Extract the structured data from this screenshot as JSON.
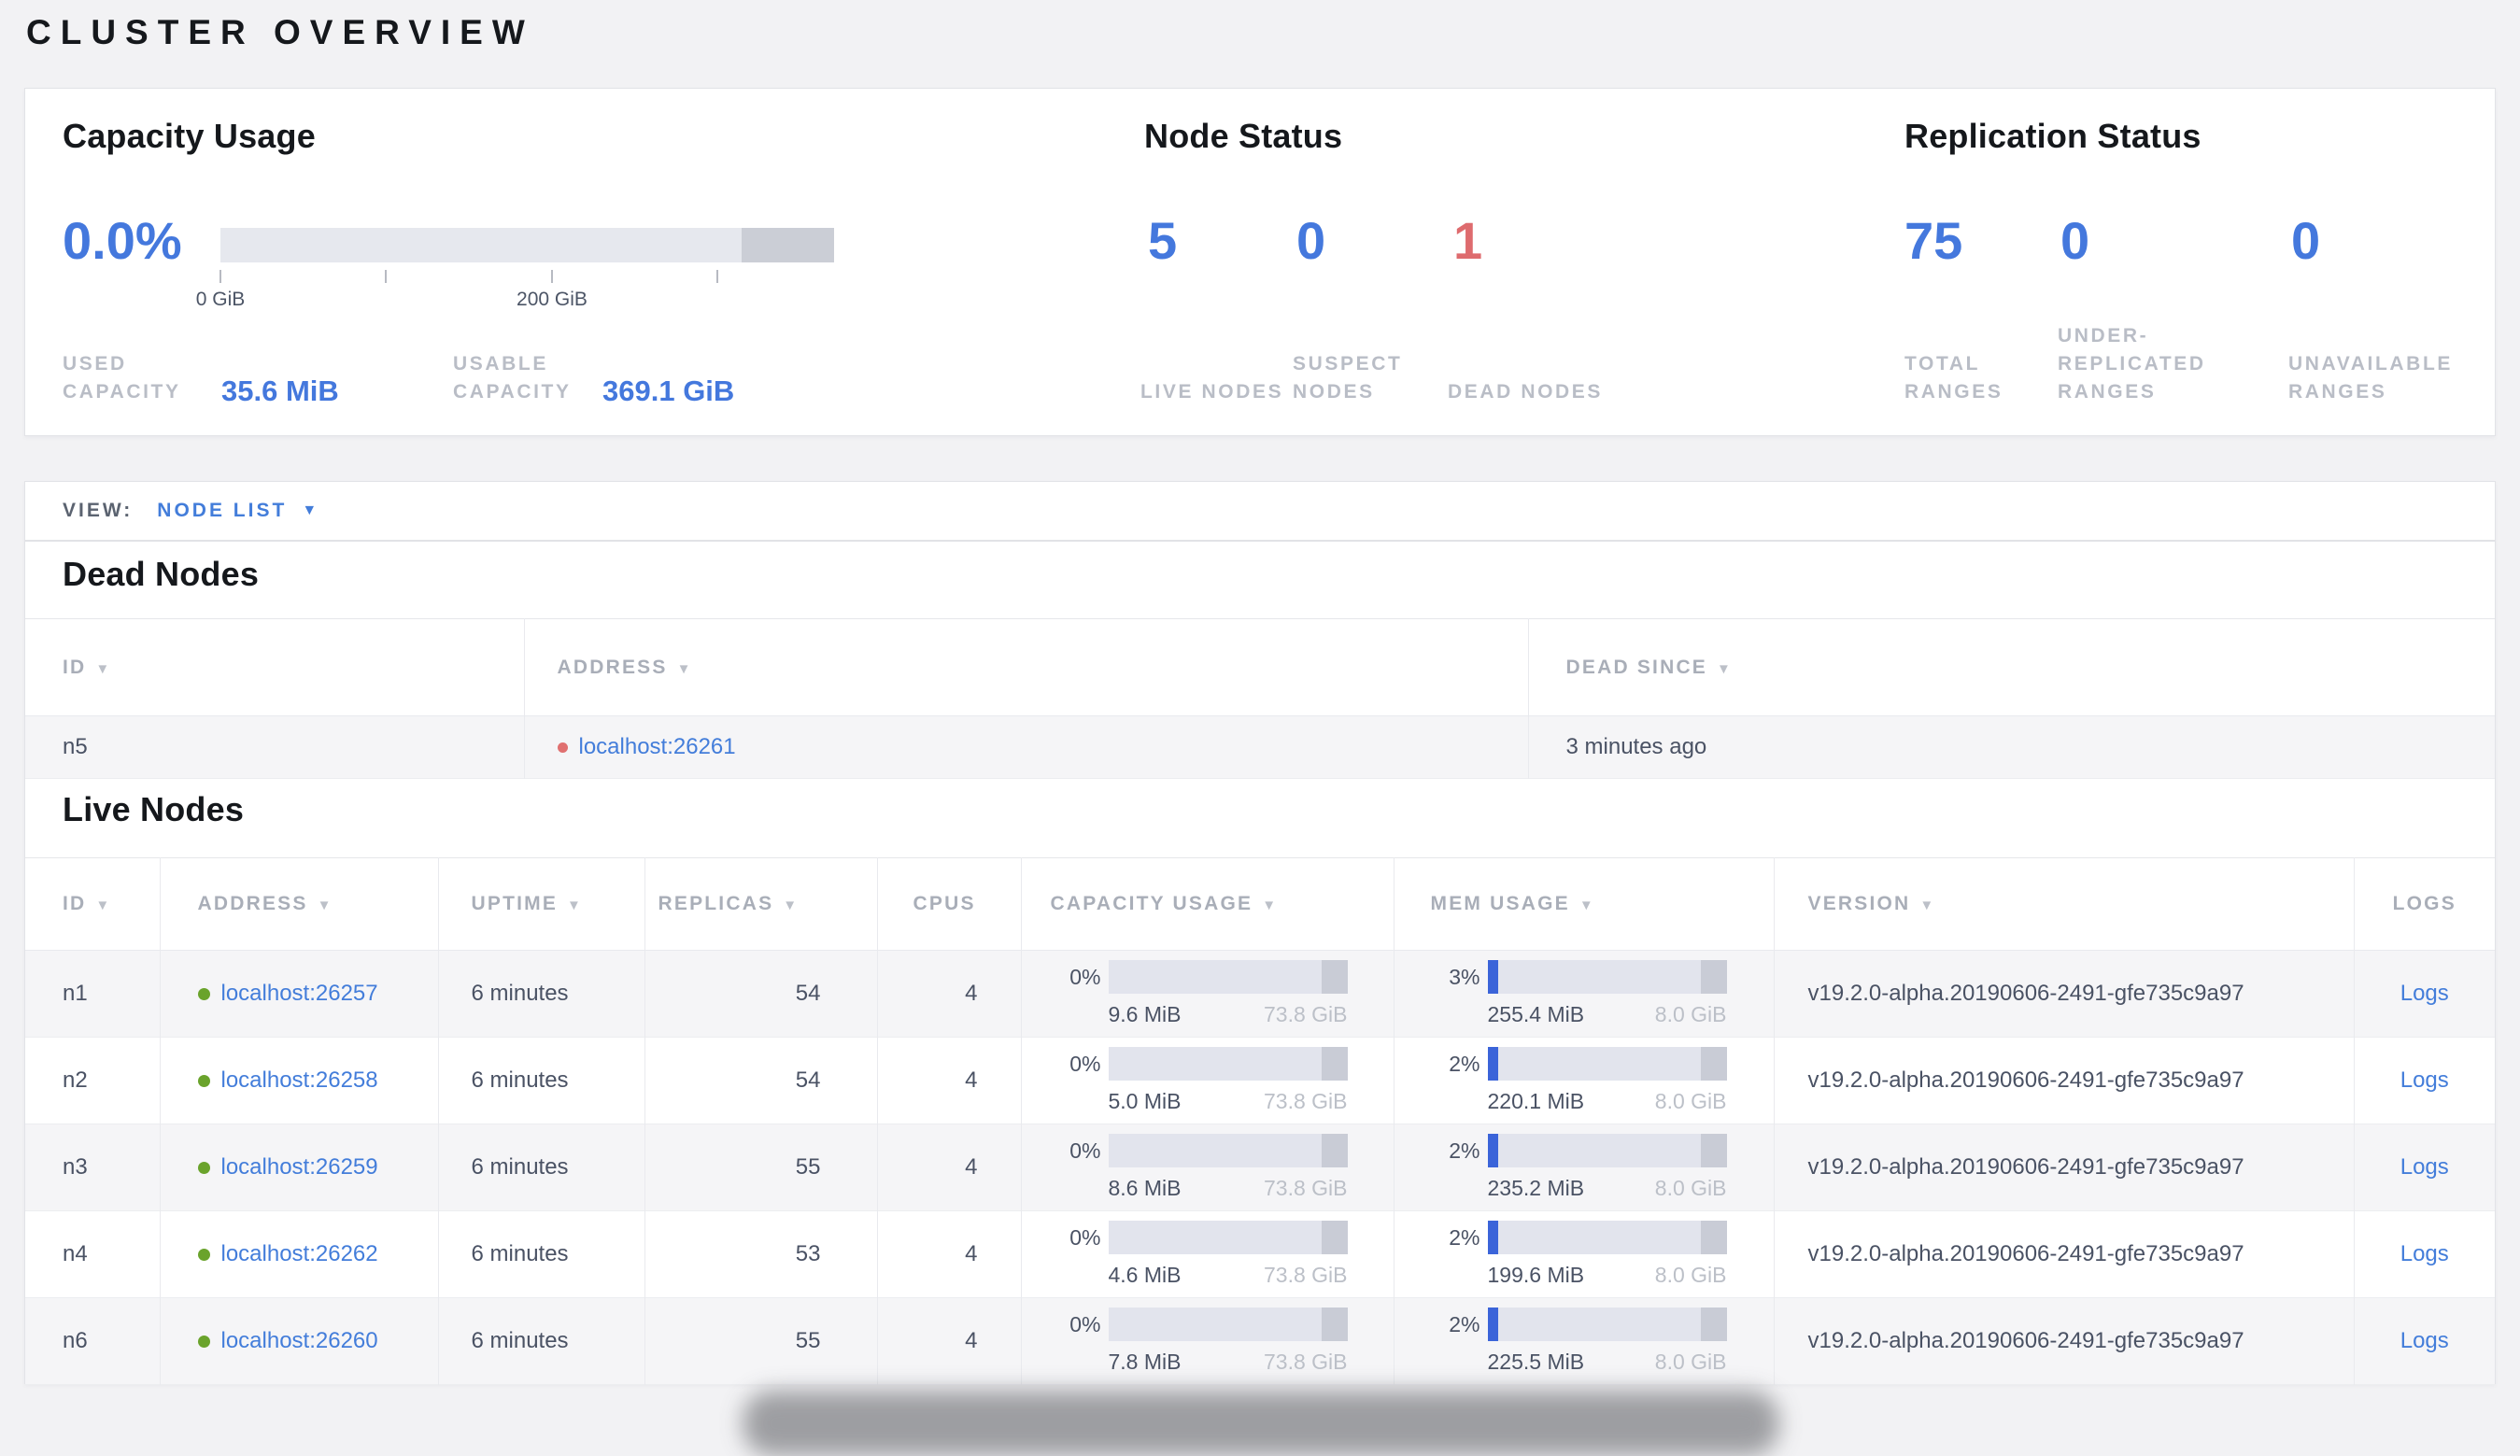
{
  "page_title": "CLUSTER OVERVIEW",
  "colors": {
    "accent_blue": "#437dda",
    "number_blue": "#4478dd",
    "danger_red": "#de6b6e",
    "bar_fill_blue": "#3b64d9",
    "bar_track": "#e2e4ed",
    "bar_cap_gray": "#c9ccd6",
    "live_dot_green": "#6aa32c",
    "dead_dot_red": "#e07070",
    "label_gray": "#b9bdc6",
    "panel_bg": "#ffffff",
    "page_bg": "#f2f2f4"
  },
  "icons": {
    "sort_desc": "▼",
    "caret_down": "▼"
  },
  "summary": {
    "capacity": {
      "title": "Capacity Usage",
      "percent": "0.0%",
      "axis_ticks": [
        "0 GiB",
        "200 GiB"
      ],
      "stats": [
        {
          "label": "USED CAPACITY",
          "value": "35.6 MiB"
        },
        {
          "label": "USABLE CAPACITY",
          "value": "369.1 GiB"
        }
      ]
    },
    "node_status": {
      "title": "Node Status",
      "stats": [
        {
          "value": "5",
          "label": "LIVE NODES"
        },
        {
          "value": "0",
          "label": "SUSPECT NODES"
        },
        {
          "value": "1",
          "label": "DEAD NODES"
        }
      ]
    },
    "replication_status": {
      "title": "Replication Status",
      "stats": [
        {
          "value": "75",
          "label": "TOTAL RANGES"
        },
        {
          "value": "0",
          "label": "UNDER-REPLICATED RANGES"
        },
        {
          "value": "0",
          "label": "UNAVAILABLE RANGES"
        }
      ]
    }
  },
  "view_bar": {
    "label": "VIEW:",
    "selected": "NODE LIST"
  },
  "dead_nodes": {
    "title": "Dead Nodes",
    "columns": [
      {
        "label": "ID"
      },
      {
        "label": "ADDRESS"
      },
      {
        "label": "DEAD SINCE"
      }
    ],
    "rows": [
      {
        "id": "n5",
        "address": "localhost:26261",
        "dead_since": "3 minutes ago"
      }
    ]
  },
  "live_nodes": {
    "title": "Live Nodes",
    "columns": [
      {
        "label": "ID"
      },
      {
        "label": "ADDRESS"
      },
      {
        "label": "UPTIME"
      },
      {
        "label": "REPLICAS"
      },
      {
        "label": "CPUS"
      },
      {
        "label": "CAPACITY USAGE"
      },
      {
        "label": "MEM USAGE"
      },
      {
        "label": "VERSION"
      },
      {
        "label": "LOGS"
      }
    ],
    "rows": [
      {
        "id": "n1",
        "address": "localhost:26257",
        "uptime": "6 minutes",
        "replicas": "54",
        "cpus": "4",
        "capacity": {
          "percent": "0%",
          "used": "9.6 MiB",
          "usable": "73.8 GiB"
        },
        "memory": {
          "percent": "3%",
          "used": "255.4 MiB",
          "total": "8.0 GiB"
        },
        "version": "v19.2.0-alpha.20190606-2491-gfe735c9a97",
        "logs": "Logs"
      },
      {
        "id": "n2",
        "address": "localhost:26258",
        "uptime": "6 minutes",
        "replicas": "54",
        "cpus": "4",
        "capacity": {
          "percent": "0%",
          "used": "5.0 MiB",
          "usable": "73.8 GiB"
        },
        "memory": {
          "percent": "2%",
          "used": "220.1 MiB",
          "total": "8.0 GiB"
        },
        "version": "v19.2.0-alpha.20190606-2491-gfe735c9a97",
        "logs": "Logs"
      },
      {
        "id": "n3",
        "address": "localhost:26259",
        "uptime": "6 minutes",
        "replicas": "55",
        "cpus": "4",
        "capacity": {
          "percent": "0%",
          "used": "8.6 MiB",
          "usable": "73.8 GiB"
        },
        "memory": {
          "percent": "2%",
          "used": "235.2 MiB",
          "total": "8.0 GiB"
        },
        "version": "v19.2.0-alpha.20190606-2491-gfe735c9a97",
        "logs": "Logs"
      },
      {
        "id": "n4",
        "address": "localhost:26262",
        "uptime": "6 minutes",
        "replicas": "53",
        "cpus": "4",
        "capacity": {
          "percent": "0%",
          "used": "4.6 MiB",
          "usable": "73.8 GiB"
        },
        "memory": {
          "percent": "2%",
          "used": "199.6 MiB",
          "total": "8.0 GiB"
        },
        "version": "v19.2.0-alpha.20190606-2491-gfe735c9a97",
        "logs": "Logs"
      },
      {
        "id": "n6",
        "address": "localhost:26260",
        "uptime": "6 minutes",
        "replicas": "55",
        "cpus": "4",
        "capacity": {
          "percent": "0%",
          "used": "7.8 MiB",
          "usable": "73.8 GiB"
        },
        "memory": {
          "percent": "2%",
          "used": "225.5 MiB",
          "total": "8.0 GiB"
        },
        "version": "v19.2.0-alpha.20190606-2491-gfe735c9a97",
        "logs": "Logs"
      }
    ]
  }
}
